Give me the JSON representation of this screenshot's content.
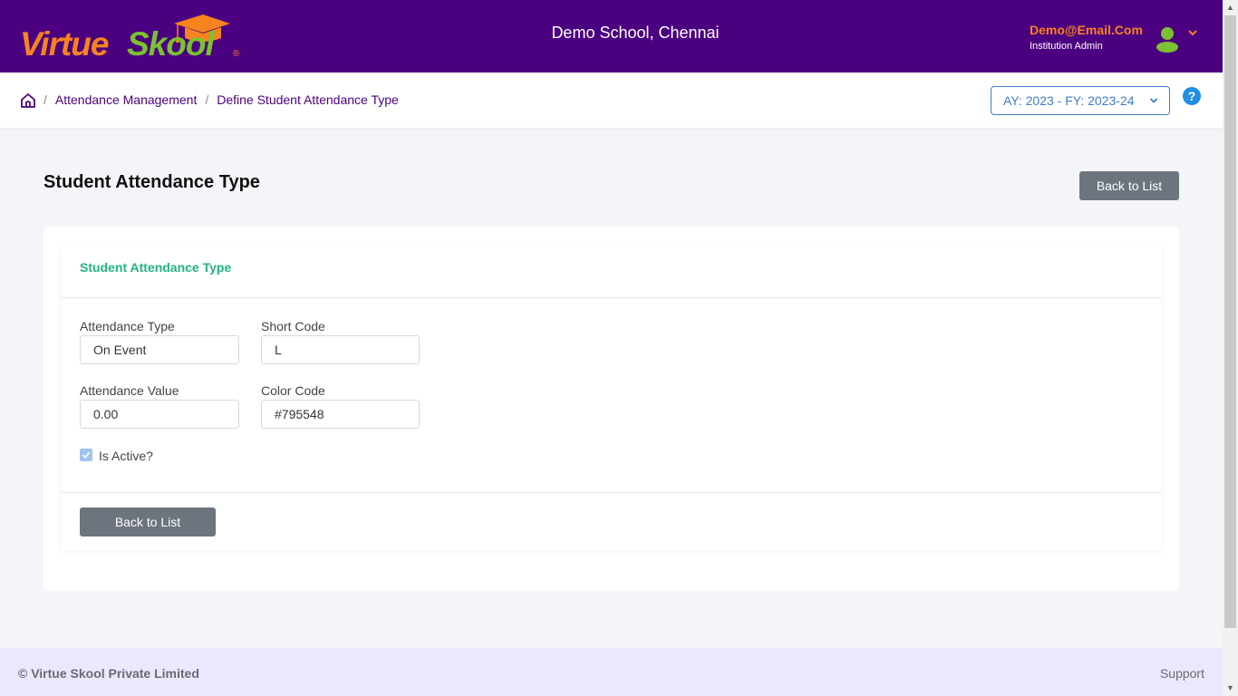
{
  "header": {
    "logo": {
      "part1": "Virtue",
      "part2": "Skool",
      "reg": "®"
    },
    "school_name": "Demo School, Chennai",
    "user": {
      "email": "Demo@Email.Com",
      "role": "Institution Admin"
    }
  },
  "breadcrumb": {
    "items": [
      "Attendance Management",
      "Define Student Attendance Type"
    ],
    "separator": "/"
  },
  "year_selector": {
    "value": "AY: 2023 - FY: 2023-24"
  },
  "help": {
    "label": "?"
  },
  "page": {
    "title": "Student Attendance Type",
    "back_button": "Back to List"
  },
  "form": {
    "card_title": "Student Attendance Type",
    "fields": {
      "attendance_type": {
        "label": "Attendance Type",
        "value": "On Event"
      },
      "short_code": {
        "label": "Short Code",
        "value": "L"
      },
      "attendance_value": {
        "label": "Attendance Value",
        "value": "0.00"
      },
      "color_code": {
        "label": "Color Code",
        "value": "#795548"
      }
    },
    "is_active": {
      "label": "Is Active?",
      "checked": true
    },
    "back_button": "Back to List"
  },
  "footer": {
    "copyright": "© Virtue Skool Private Limited",
    "support": "Support"
  },
  "colors": {
    "header_bg": "#4b0080",
    "brand_orange": "#f7831f",
    "brand_green": "#7ac231",
    "card_title": "#22b57c",
    "button_gray": "#6c757d",
    "footer_bg": "#ebe7fc"
  }
}
